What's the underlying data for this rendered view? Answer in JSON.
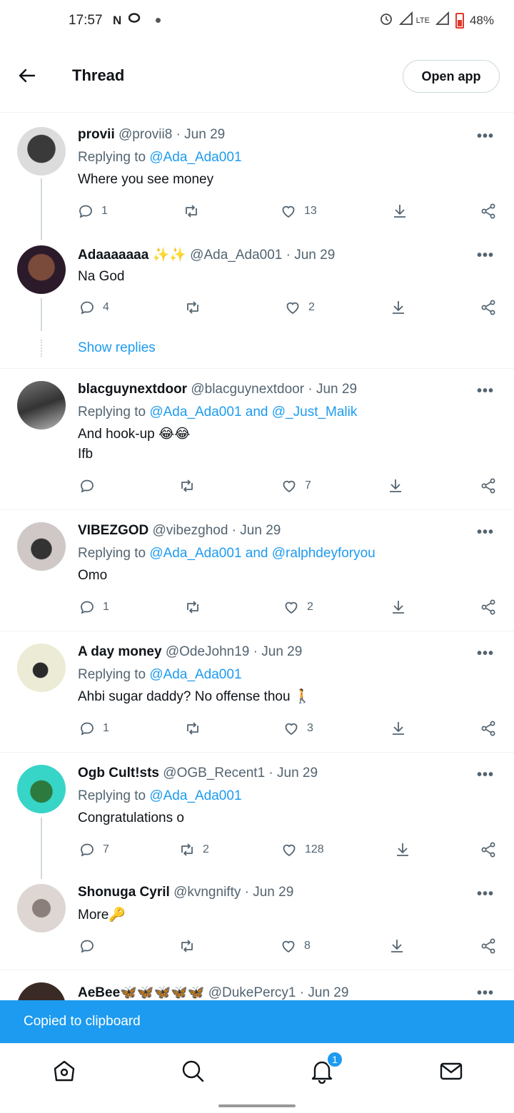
{
  "status_bar": {
    "time": "17:57",
    "left_icons": "N",
    "network": "LTE",
    "battery": "48%"
  },
  "header": {
    "title": "Thread",
    "open_app": "Open app"
  },
  "tweets": [
    {
      "name": "provii",
      "meta": "@provii8 · Jun 29",
      "replying_prefix": "Replying to ",
      "replying_to": "@Ada_Ada001",
      "text": "Where you see money",
      "replies": "1",
      "retweets": "",
      "likes": "13"
    },
    {
      "name": "Adaaaaaaa ✨✨",
      "meta": "@Ada_Ada001 · Jun 29",
      "text": "Na God",
      "replies": "4",
      "retweets": "",
      "likes": "2"
    },
    {
      "name": "blacguynextdoor",
      "meta": "@blacguynextdoor · Jun 29",
      "replying_prefix": "Replying to ",
      "replying_to": "@Ada_Ada001 and @_Just_Malik",
      "text": "And hook-up 😂😂",
      "text2": "Ifb",
      "replies": "",
      "retweets": "",
      "likes": "7"
    },
    {
      "name": "VIBEZGOD",
      "meta": "@vibezghod · Jun 29",
      "replying_prefix": "Replying to ",
      "replying_to": "@Ada_Ada001 and @ralphdeyforyou",
      "text": "Omo",
      "replies": "1",
      "retweets": "",
      "likes": "2"
    },
    {
      "name": "A day money",
      "meta": "@OdeJohn19 · Jun 29",
      "replying_prefix": "Replying to ",
      "replying_to": "@Ada_Ada001",
      "text": "Ahbi sugar daddy? No offense thou 🚶",
      "replies": "1",
      "retweets": "",
      "likes": "3"
    },
    {
      "name": "Ogb Cult!sts",
      "meta": "@OGB_Recent1 · Jun 29",
      "replying_prefix": "Replying to ",
      "replying_to": "@Ada_Ada001",
      "text": "Congratulations o",
      "replies": "7",
      "retweets": "2",
      "likes": "128"
    },
    {
      "name": "Shonuga Cyril",
      "meta": "@kvngnifty · Jun 29",
      "text": "More🔑",
      "replies": "",
      "retweets": "",
      "likes": "8"
    },
    {
      "name": "AeBee🦋🦋🦋🦋🦋",
      "meta": "@DukePercy1 · Jun 29"
    }
  ],
  "show_replies": "Show replies",
  "toast": "Copied to clipboard",
  "bottom_nav": {
    "notifications_badge": "1"
  },
  "colors": {
    "accent": "#1d9bf0",
    "text": "#0f1419",
    "muted": "#536471"
  }
}
